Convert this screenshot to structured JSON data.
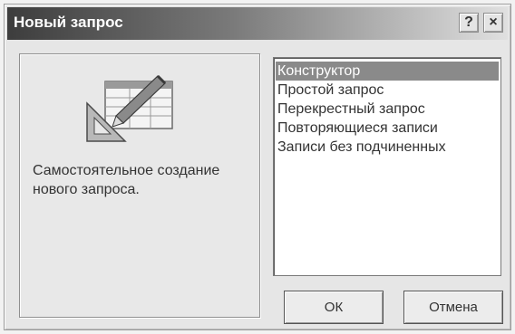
{
  "window": {
    "title": "Новый запрос",
    "help_label": "?",
    "close_label": "×"
  },
  "preview": {
    "icon": "query-design-icon",
    "description": "Самостоятельное создание\nнового запроса."
  },
  "query_types": {
    "items": [
      "Конструктор",
      "Простой запрос",
      "Перекрестный запрос",
      "Повторяющиеся записи",
      "Записи без подчиненных"
    ],
    "selected_index": 0
  },
  "buttons": {
    "ok_label": "ОК",
    "cancel_label": "Отмена"
  }
}
